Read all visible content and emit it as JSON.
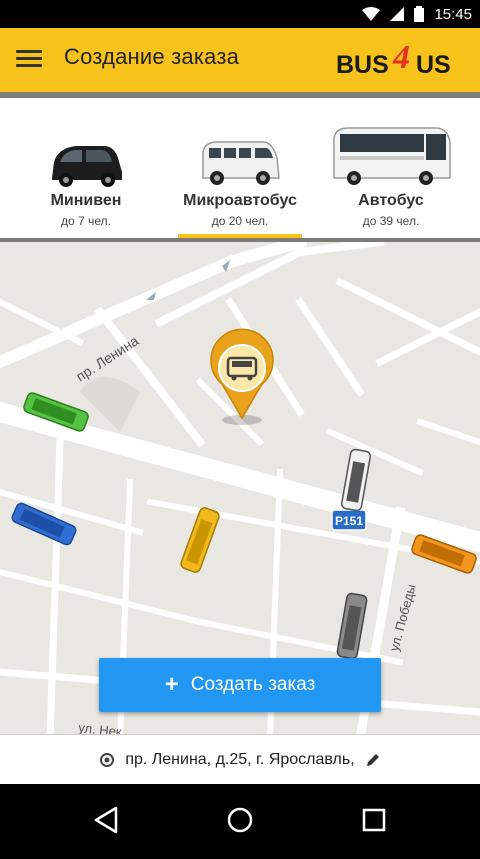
{
  "status": {
    "time": "15:45"
  },
  "header": {
    "title": "Создание заказа",
    "logo_left": "BUS",
    "logo_mid": "4",
    "logo_right": "US",
    "accent_color": "#f7c21a"
  },
  "vehicles": [
    {
      "name": "Минивен",
      "capacity": "до 7 чел.",
      "selected": false
    },
    {
      "name": "Микроавтобус",
      "capacity": "до 20 чел.",
      "selected": true
    },
    {
      "name": "Автобус",
      "capacity": "до 39 чел.",
      "selected": false
    }
  ],
  "map": {
    "streets": {
      "lenina": "пр. Ленина",
      "pobedy": "ул. Победы",
      "bottom": "ул. Нек"
    },
    "road_sign": "Р151"
  },
  "actions": {
    "create_label": "Создать заказ",
    "create_color": "#2196f3"
  },
  "address": {
    "text": "пр. Ленина, д.25, г. Ярославль,"
  }
}
